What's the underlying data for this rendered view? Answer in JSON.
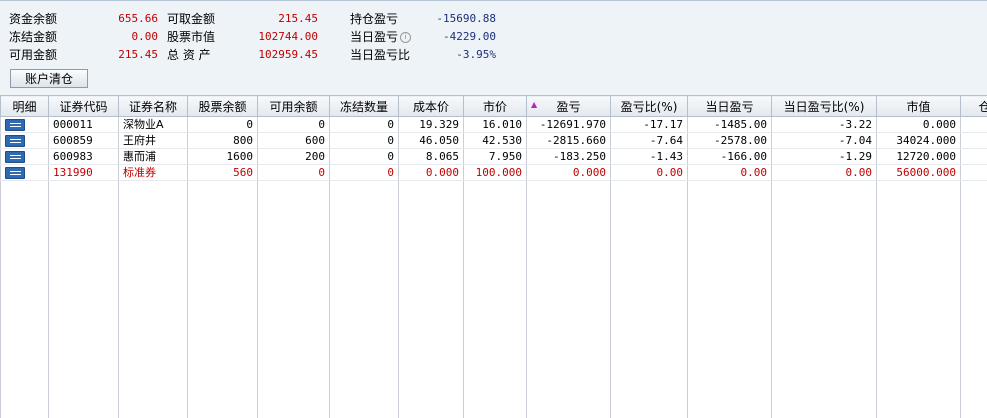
{
  "summary": {
    "fund_balance": {
      "label": "资金余额",
      "value": "655.66"
    },
    "frozen_amount": {
      "label": "冻结金额",
      "value": "0.00"
    },
    "available_amount": {
      "label": "可用金额",
      "value": "215.45"
    },
    "withdrawable": {
      "label": "可取金额",
      "value": "215.45"
    },
    "stock_value": {
      "label": "股票市值",
      "value": "102744.00"
    },
    "total_assets": {
      "label": "总 资 产",
      "value": "102959.45"
    },
    "position_pnl": {
      "label": "持仓盈亏",
      "value": "-15690.88"
    },
    "today_pnl": {
      "label": "当日盈亏",
      "value": "-4229.00",
      "info_icon": "info-icon"
    },
    "today_pnl_ratio": {
      "label": "当日盈亏比",
      "value": "-3.95%"
    }
  },
  "clear_button_label": "账户清仓",
  "table": {
    "columns": [
      "明细",
      "证券代码",
      "证券名称",
      "股票余额",
      "可用余额",
      "冻结数量",
      "成本价",
      "市价",
      "盈亏",
      "盈亏比(%)",
      "当日盈亏",
      "当日盈亏比(%)",
      "市值",
      "仓位"
    ],
    "sorted_column_icon": "sort-descending-triangle",
    "rows": [
      {
        "code": "000011",
        "name": "深物业A",
        "balance": "0",
        "available": "0",
        "frozen": "0",
        "cost": "19.329",
        "price": "16.010",
        "pnl": "-12691.970",
        "pnl_ratio": "-17.17",
        "today_pnl": "-1485.00",
        "today_ratio": "-3.22",
        "market_value": "0.000",
        "position": "",
        "highlight": false
      },
      {
        "code": "600859",
        "name": "王府井",
        "balance": "800",
        "available": "600",
        "frozen": "0",
        "cost": "46.050",
        "price": "42.530",
        "pnl": "-2815.660",
        "pnl_ratio": "-7.64",
        "today_pnl": "-2578.00",
        "today_ratio": "-7.04",
        "market_value": "34024.000",
        "position": "",
        "highlight": false
      },
      {
        "code": "600983",
        "name": "惠而浦",
        "balance": "1600",
        "available": "200",
        "frozen": "0",
        "cost": "8.065",
        "price": "7.950",
        "pnl": "-183.250",
        "pnl_ratio": "-1.43",
        "today_pnl": "-166.00",
        "today_ratio": "-1.29",
        "market_value": "12720.000",
        "position": "",
        "highlight": false
      },
      {
        "code": "131990",
        "name": "标准券",
        "balance": "560",
        "available": "0",
        "frozen": "0",
        "cost": "0.000",
        "price": "100.000",
        "pnl": "0.000",
        "pnl_ratio": "0.00",
        "today_pnl": "0.00",
        "today_ratio": "0.00",
        "market_value": "56000.000",
        "position": "",
        "highlight": true
      }
    ]
  }
}
